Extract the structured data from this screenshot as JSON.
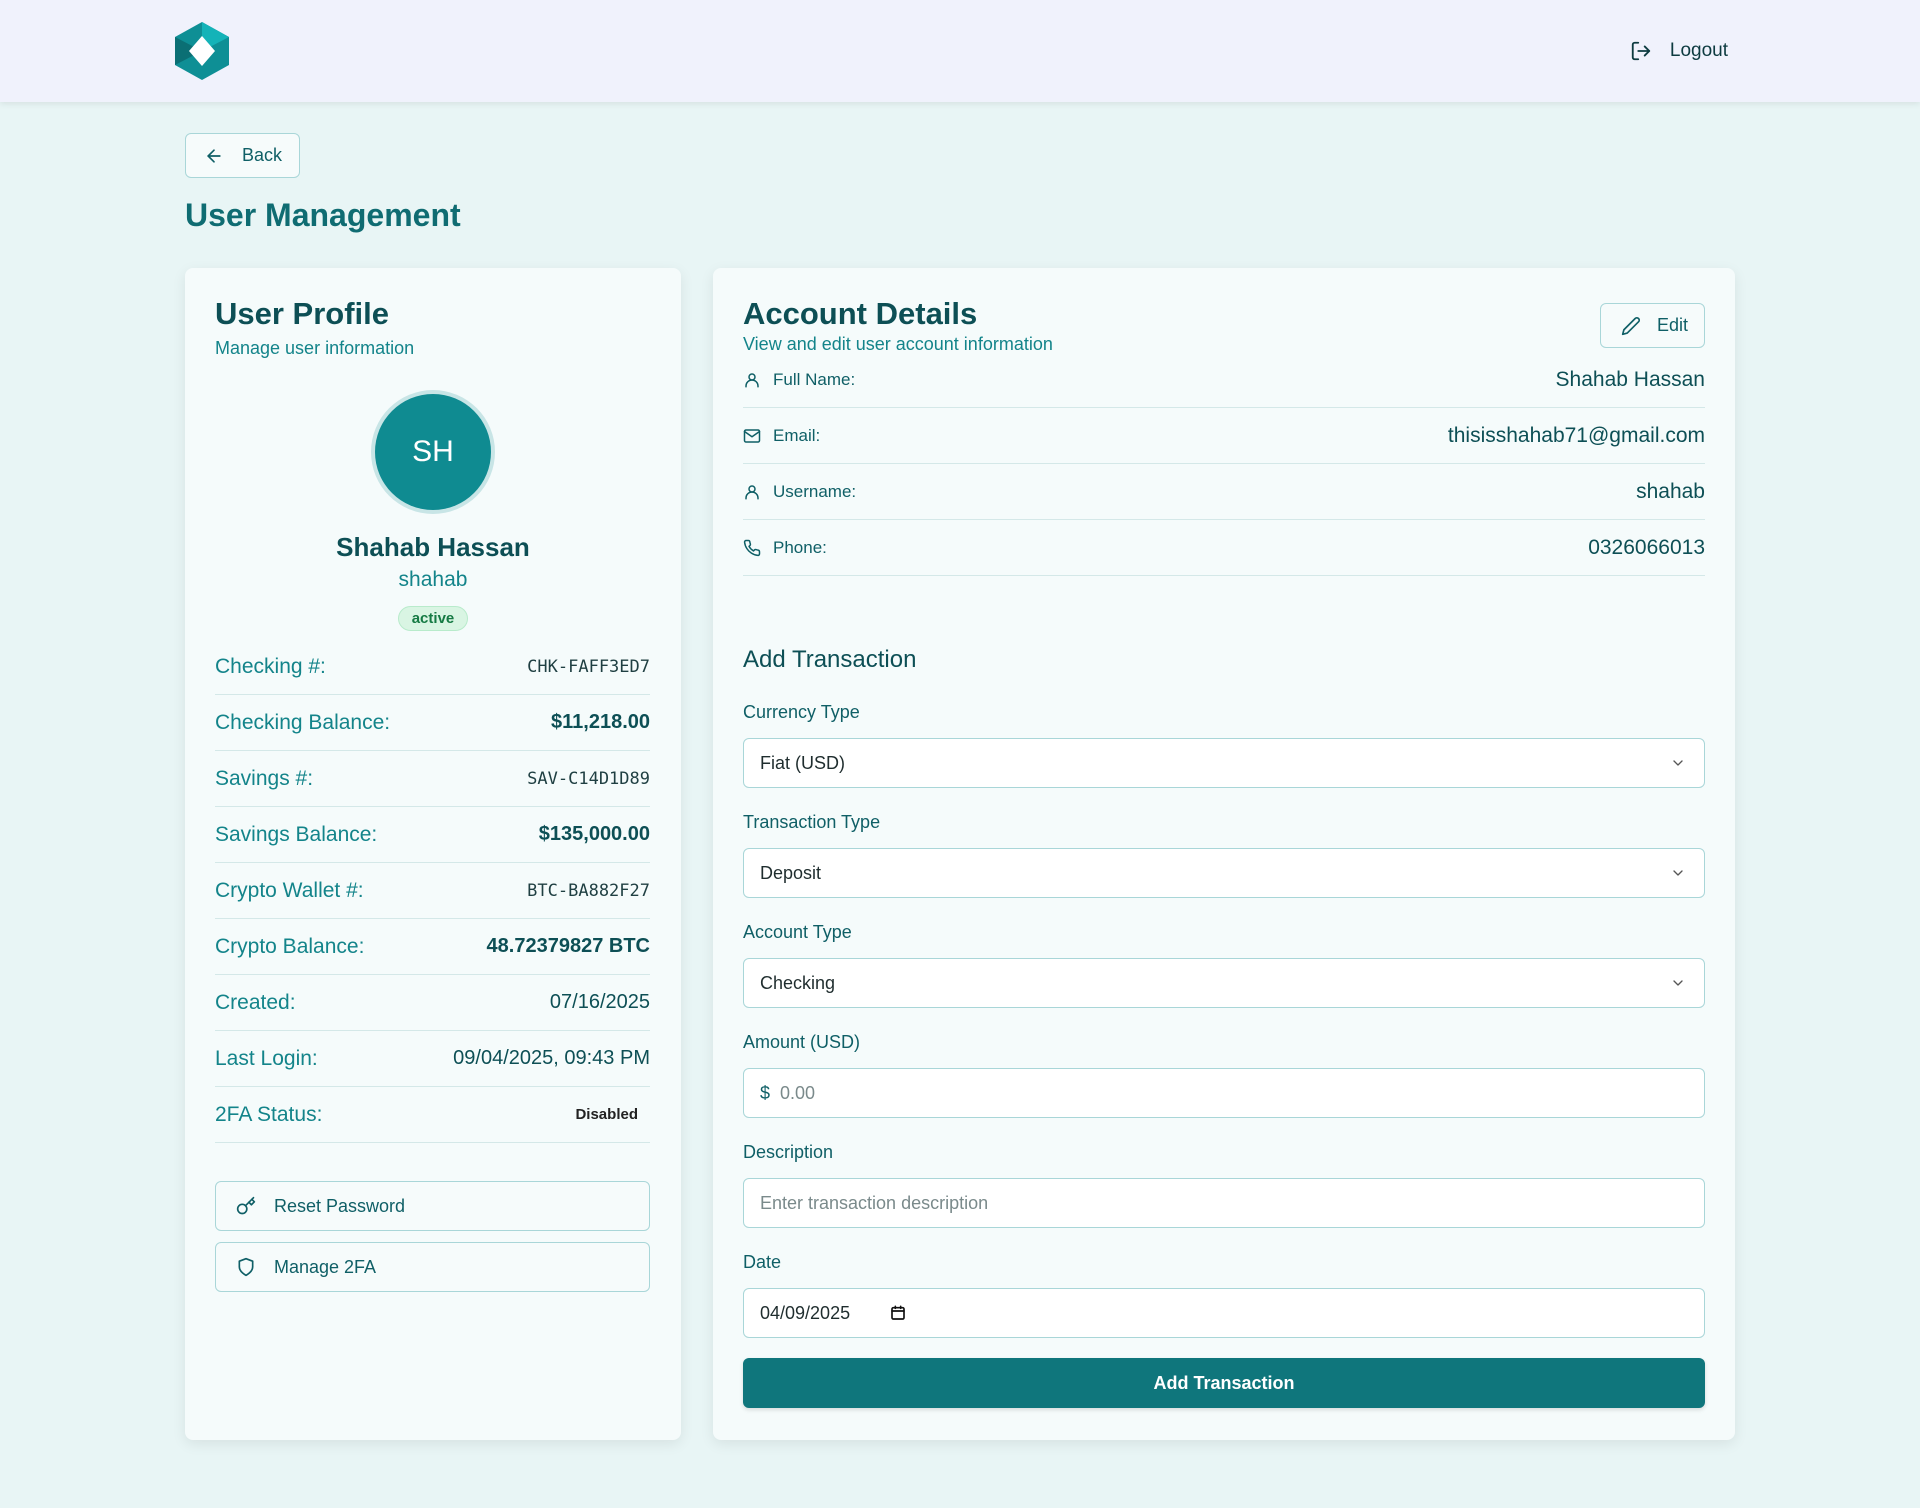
{
  "header": {
    "logo_icon": "hexagon-logo-icon",
    "logout_label": "Logout"
  },
  "nav": {
    "back_label": "Back"
  },
  "page": {
    "title": "User Management"
  },
  "profile": {
    "title": "User Profile",
    "subtitle": "Manage user information",
    "initials": "SH",
    "name": "Shahab Hassan",
    "username": "shahab",
    "status": "active",
    "rows": [
      {
        "label": "Checking #:",
        "value": "CHK-FAFF3ED7"
      },
      {
        "label": "Checking Balance:",
        "value": "$11,218.00"
      },
      {
        "label": "Savings #:",
        "value": "SAV-C14D1D89"
      },
      {
        "label": "Savings Balance:",
        "value": "$135,000.00"
      },
      {
        "label": "Crypto Wallet #:",
        "value": "BTC-BA882F27"
      },
      {
        "label": "Crypto Balance:",
        "value": "48.72379827 BTC"
      },
      {
        "label": "Created:",
        "value": "07/16/2025"
      },
      {
        "label": "Last Login:",
        "value": "09/04/2025, 09:43 PM"
      },
      {
        "label": "2FA Status:",
        "value": "Disabled"
      }
    ],
    "reset_password_label": "Reset Password",
    "manage_2fa_label": "Manage 2FA"
  },
  "account": {
    "title": "Account Details",
    "subtitle": "View and edit user account information",
    "edit_label": "Edit",
    "fields": [
      {
        "icon": "user-icon",
        "label": "Full Name:",
        "value": "Shahab Hassan"
      },
      {
        "icon": "mail-icon",
        "label": "Email:",
        "value": "thisisshahab71@gmail.com"
      },
      {
        "icon": "user-icon",
        "label": "Username:",
        "value": "shahab"
      },
      {
        "icon": "phone-icon",
        "label": "Phone:",
        "value": "0326066013"
      }
    ]
  },
  "transaction": {
    "title": "Add Transaction",
    "currency_label": "Currency Type",
    "currency_value": "Fiat (USD)",
    "type_label": "Transaction Type",
    "type_value": "Deposit",
    "account_label": "Account Type",
    "account_value": "Checking",
    "amount_label": "Amount (USD)",
    "amount_prefix": "$",
    "amount_placeholder": "0.00",
    "description_label": "Description",
    "description_placeholder": "Enter transaction description",
    "date_label": "Date",
    "date_value": "04/09/2025",
    "submit_label": "Add Transaction"
  }
}
